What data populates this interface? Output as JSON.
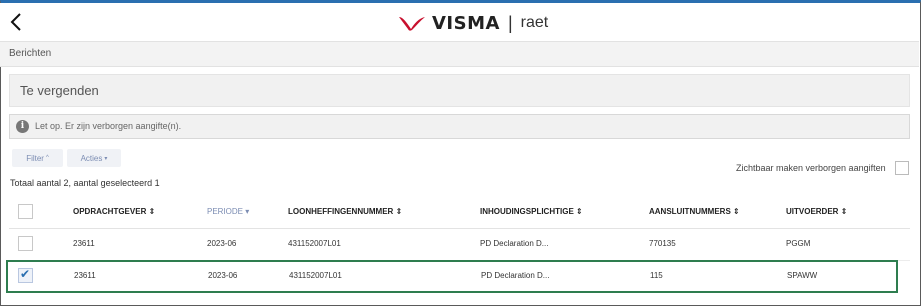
{
  "header": {
    "back_icon": "chevron-left-icon",
    "logo_brand": "VISMA",
    "logo_separator": "|",
    "logo_product": "raet"
  },
  "breadcrumb": {
    "label": "Berichten"
  },
  "page": {
    "title": "Te vergenden"
  },
  "notice": {
    "icon": "info-icon",
    "icon_glyph": "i",
    "text": "Let op. Er zijn verborgen aangifte(n)."
  },
  "toolbar": {
    "filter_label": "Filter",
    "filter_caret": "^",
    "acties_label": "Acties",
    "acties_caret": "▾"
  },
  "summary": {
    "text": "Totaal aantal 2, aantal geselecteerd 1"
  },
  "hidden_toggle": {
    "label": "Zichtbaar maken verborgen aangiften",
    "checked": false
  },
  "table": {
    "columns": [
      {
        "label": "OPDRACHTGEVER",
        "sort": "⇕"
      },
      {
        "label": "PERIODE",
        "sort": "▾"
      },
      {
        "label": "LOONHEFFINGENNUMMER",
        "sort": "⇕"
      },
      {
        "label": "INHOUDINGSPLICHTIGE",
        "sort": "⇕"
      },
      {
        "label": "AANSLUITNUMMERS",
        "sort": "⇕"
      },
      {
        "label": "UITVOERDER",
        "sort": "⇕"
      }
    ],
    "rows": [
      {
        "checked": false,
        "opdrachtgever": "23611",
        "periode": "2023-06",
        "loonheffingennummer": "431152007L01",
        "inhoudingsplichtige": "PD Declaration D...",
        "aansluitnummers": "770135",
        "uitvoerder": "PGGM"
      },
      {
        "checked": true,
        "opdrachtgever": "23611",
        "periode": "2023-06",
        "loonheffingennummer": "431152007L01",
        "inhoudingsplichtige": "PD Declaration D...",
        "aansluitnummers": "115",
        "uitvoerder": "SPAWW"
      }
    ],
    "check_glyph": "✔"
  },
  "colors": {
    "accent_top": "#2a6fb0",
    "selected_row_border": "#2e7d4f",
    "button_text": "#7c8db3",
    "logo_red": "#c8102e"
  }
}
